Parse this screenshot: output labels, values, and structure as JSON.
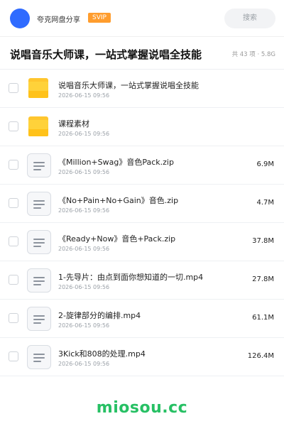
{
  "header": {
    "brand_name": "夸克网盘分享",
    "badge": "SVIP",
    "search_label": "搜索"
  },
  "share": {
    "title": "说唱音乐大师课，一站式掌握说唱全技能",
    "summary": "共 43 项 · 5.8G"
  },
  "files": [
    {
      "type": "folder",
      "name": "说唱音乐大师课，一站式掌握说唱全技能",
      "date": "2026-06-15 09:56",
      "size": ""
    },
    {
      "type": "folder",
      "name": "课程素材",
      "date": "2026-06-15 09:56",
      "size": ""
    },
    {
      "type": "file",
      "name": "《Million+Swag》音色Pack.zip",
      "date": "2026-06-15 09:56",
      "size": "6.9M"
    },
    {
      "type": "file",
      "name": "《No+Pain+No+Gain》音色.zip",
      "date": "2026-06-15 09:56",
      "size": "4.7M"
    },
    {
      "type": "file",
      "name": "《Ready+Now》音色+Pack.zip",
      "date": "2026-06-15 09:56",
      "size": "37.8M"
    },
    {
      "type": "file",
      "name": "1-先导片：由点到面你想知道的一切.mp4",
      "date": "2026-06-15 09:56",
      "size": "27.8M"
    },
    {
      "type": "file",
      "name": "2-旋律部分的编排.mp4",
      "date": "2026-06-15 09:56",
      "size": "61.1M"
    },
    {
      "type": "file",
      "name": "3Kick和808的处理.mp4",
      "date": "2026-06-15 09:56",
      "size": "126.4M"
    }
  ],
  "watermark": "miosou.cc",
  "colors": {
    "accent_blue": "#2f6bff",
    "svip_orange": "#ff9d2e",
    "folder_yellow": "#ffd23a",
    "watermark_green": "#27c064"
  }
}
